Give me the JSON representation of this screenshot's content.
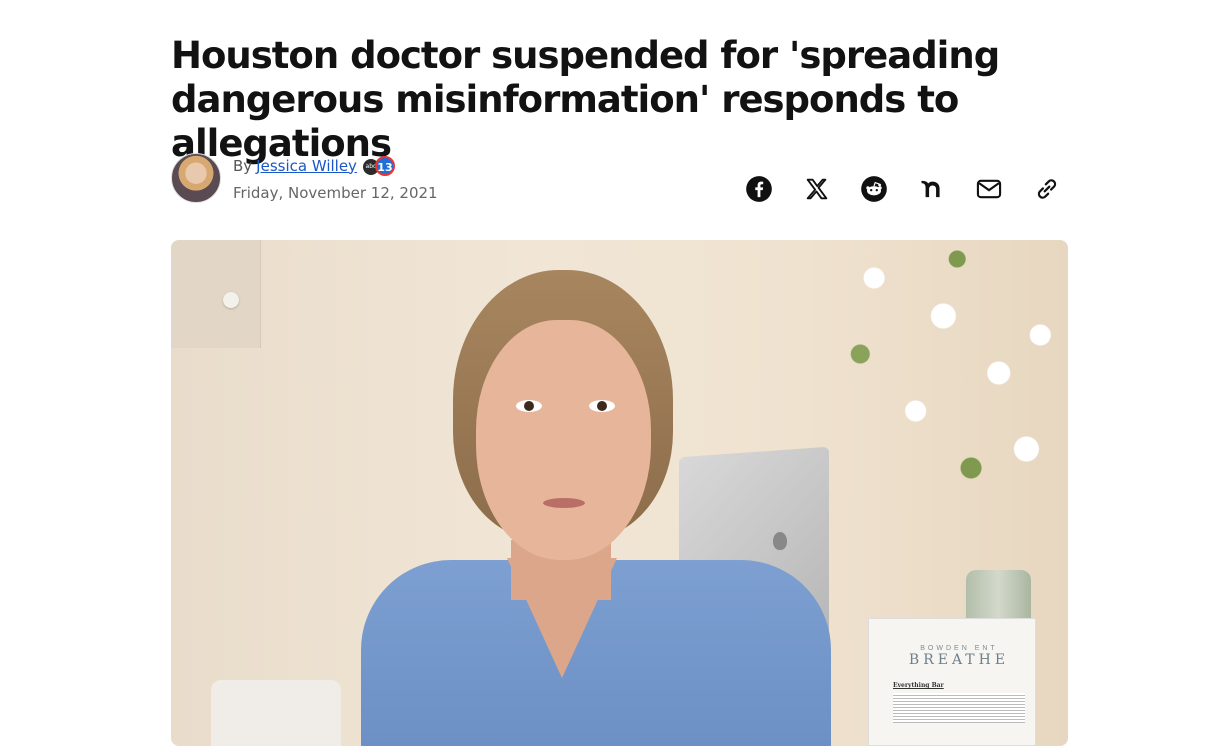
{
  "article": {
    "headline": "Houston doctor suspended for 'spreading dangerous misinformation' responds to allegations",
    "byline": {
      "prefix": "By",
      "author": "Jessica Willey",
      "station_logo_ring_text": "abc",
      "station_logo_number": "13",
      "date": "Friday, November 12, 2021"
    },
    "share": [
      {
        "name": "facebook-icon"
      },
      {
        "name": "x-icon"
      },
      {
        "name": "reddit-icon"
      },
      {
        "name": "nextdoor-icon"
      },
      {
        "name": "email-icon"
      },
      {
        "name": "link-icon"
      }
    ],
    "image": {
      "card_brand_top": "BOWDEN ENT",
      "card_brand": "BREATHE",
      "card_heading": "Everything Bar"
    }
  },
  "colors": {
    "link": "#1a57c9",
    "headline": "#121212",
    "meta": "#666666",
    "icon": "#111111"
  }
}
